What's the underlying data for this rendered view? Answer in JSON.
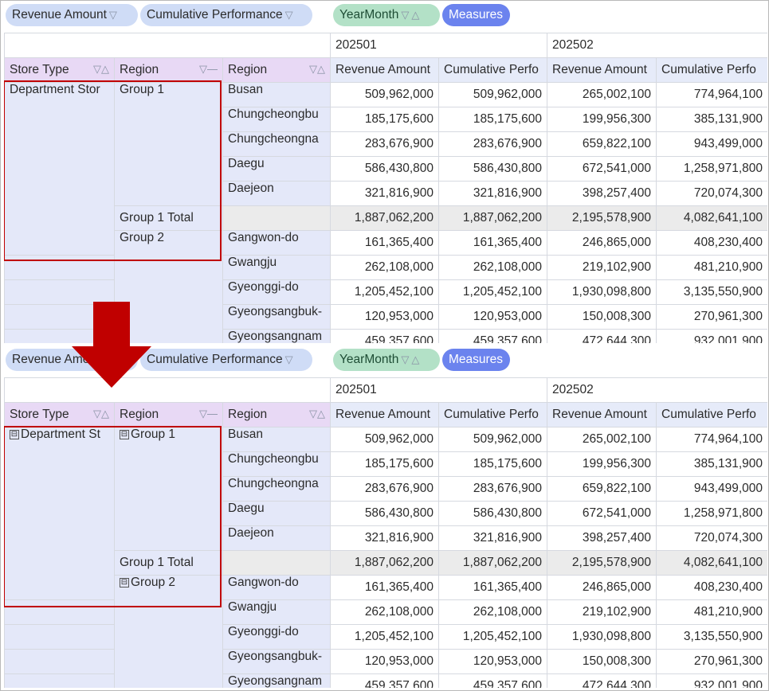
{
  "chips": {
    "revenue_amount": "Revenue Amount",
    "cumulative_performance": "Cumulative Performance",
    "yearmonth": "YearMonth",
    "measures": "Measures"
  },
  "row_headers": [
    "Store Type",
    "Region",
    "Region"
  ],
  "years": [
    "202501",
    "202502"
  ],
  "measure_headers": [
    "Revenue Amount",
    "Cumulative Perfo",
    "Revenue Amount",
    "Cumulative Perfo"
  ],
  "top": {
    "store_type": "Department Stor",
    "group1": "Group 1",
    "group2": "Group 2",
    "total": "Group 1 Total"
  },
  "bottom": {
    "store_type": "Department St",
    "group1": "Group 1",
    "group2": "Group 2",
    "total": "Group 1 Total"
  },
  "rows": [
    {
      "region": "Busan",
      "v": [
        "509,962,000",
        "509,962,000",
        "265,002,100",
        "774,964,100"
      ]
    },
    {
      "region": "Chungcheongbu",
      "v": [
        "185,175,600",
        "185,175,600",
        "199,956,300",
        "385,131,900"
      ]
    },
    {
      "region": "Chungcheongna",
      "v": [
        "283,676,900",
        "283,676,900",
        "659,822,100",
        "943,499,000"
      ]
    },
    {
      "region": "Daegu",
      "v": [
        "586,430,800",
        "586,430,800",
        "672,541,000",
        "1,258,971,800"
      ]
    },
    {
      "region": "Daejeon",
      "v": [
        "321,816,900",
        "321,816,900",
        "398,257,400",
        "720,074,300"
      ]
    },
    {
      "region": "",
      "v": [
        "1,887,062,200",
        "1,887,062,200",
        "2,195,578,900",
        "4,082,641,100"
      ]
    },
    {
      "region": "Gangwon-do",
      "v": [
        "161,365,400",
        "161,365,400",
        "246,865,000",
        "408,230,400"
      ]
    },
    {
      "region": "Gwangju",
      "v": [
        "262,108,000",
        "262,108,000",
        "219,102,900",
        "481,210,900"
      ]
    },
    {
      "region": "Gyeonggi-do",
      "v": [
        "1,205,452,100",
        "1,205,452,100",
        "1,930,098,800",
        "3,135,550,900"
      ]
    },
    {
      "region": "Gyeongsangbuk-",
      "v": [
        "120,953,000",
        "120,953,000",
        "150,008,300",
        "270,961,300"
      ]
    },
    {
      "region": "Gyeongsangnam",
      "v": [
        "459,357,600",
        "459,357,600",
        "472,644,300",
        "932,001,900"
      ]
    }
  ],
  "expand_sign": "⊟",
  "colors": {
    "highlight": "#c00000",
    "row_header": "#e8d9f5",
    "col_header": "#e6ebf9",
    "measures_chip": "#6b83ee",
    "yearmonth_chip": "#b3e1c7"
  }
}
